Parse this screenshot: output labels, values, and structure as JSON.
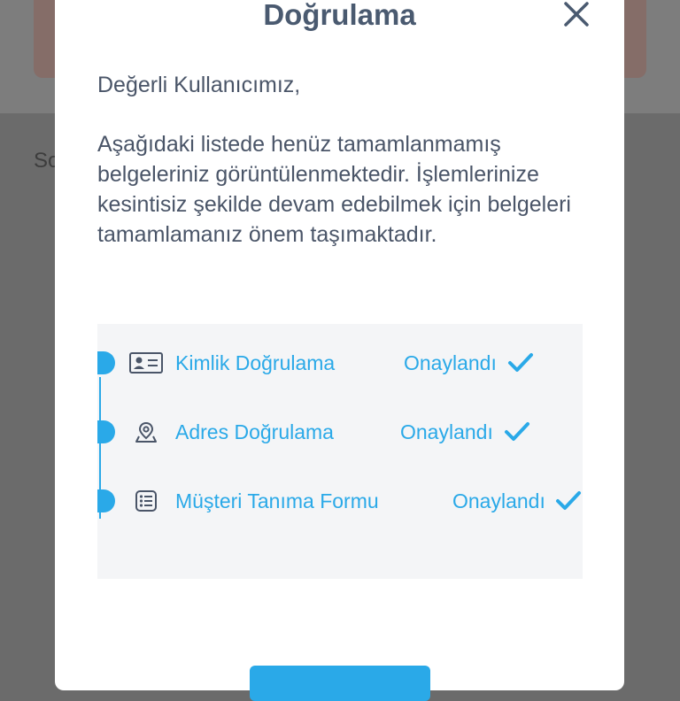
{
  "modal": {
    "title": "Doğrulama",
    "greeting": "Değerli Kullanıcımız,",
    "message": "Aşağıdaki listede henüz tamamlanmamış belgeleriniz görüntülenmektedir. İşlemlerinize kesintisiz şekilde devam edebilmek için belgeleri tamamlamanız önem taşımaktadır."
  },
  "background": {
    "partial_text": "So"
  },
  "documents": [
    {
      "label": "Kimlik Doğrulama",
      "status": "Onaylandı",
      "icon": "id-card-icon"
    },
    {
      "label": "Adres Doğrulama",
      "status": "Onaylandı",
      "icon": "location-pin-icon"
    },
    {
      "label": "Müşteri Tanıma Formu",
      "status": "Onaylandı",
      "icon": "form-list-icon"
    }
  ],
  "colors": {
    "accent": "#2aa9e8",
    "title": "#4a5a70",
    "text": "#4a5568",
    "panel": "#f4f5f7"
  }
}
